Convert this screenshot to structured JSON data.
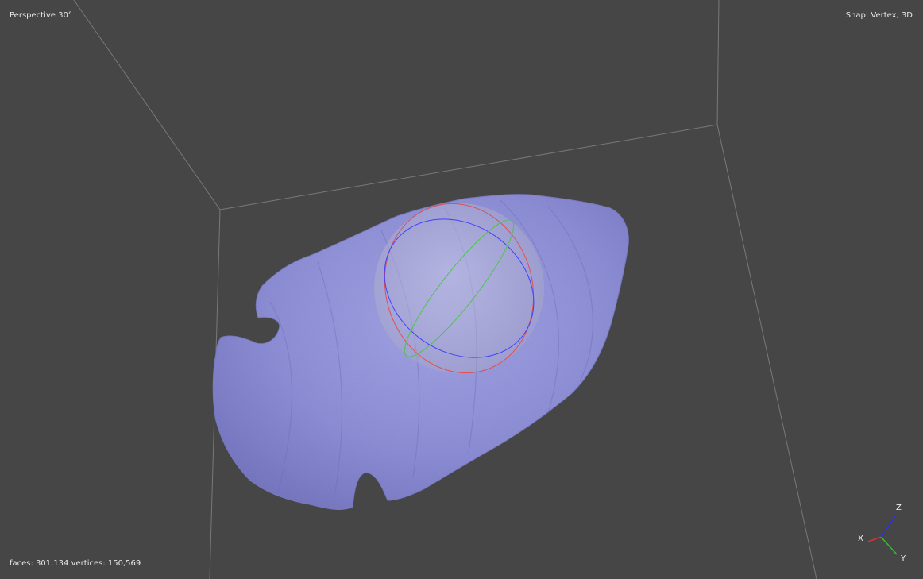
{
  "viewport": {
    "view_mode_label": "Perspective 30°",
    "snap_label": "Snap: Vertex, 3D",
    "stats_label": "faces: 301,134 vertices: 150,569",
    "mesh_color": "#8e8fd8",
    "background_color": "#464646",
    "grid_line_color": "#8a8a8a"
  },
  "gizmo": {
    "x_label": "X",
    "y_label": "Y",
    "z_label": "Z",
    "x_color": "#e03030",
    "y_color": "#30c030",
    "z_color": "#3030e0"
  },
  "trackball": {
    "red_ring_color": "#e05050",
    "green_ring_color": "#50c050",
    "blue_ring_color": "#4040ff"
  }
}
